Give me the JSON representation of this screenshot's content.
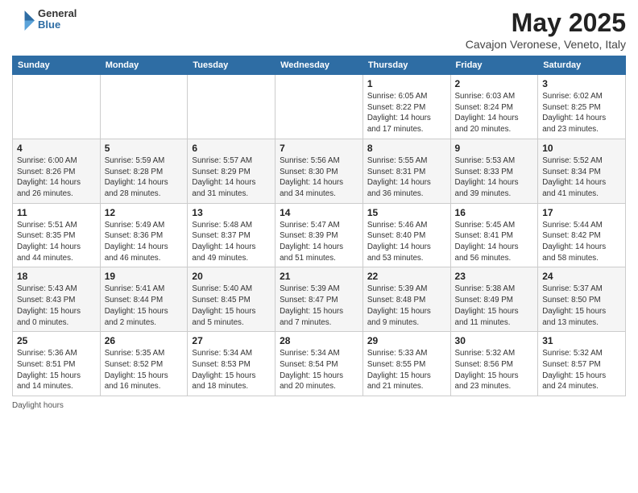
{
  "logo": {
    "general": "General",
    "blue": "Blue"
  },
  "title": {
    "month_year": "May 2025",
    "location": "Cavajon Veronese, Veneto, Italy"
  },
  "days_of_week": [
    "Sunday",
    "Monday",
    "Tuesday",
    "Wednesday",
    "Thursday",
    "Friday",
    "Saturday"
  ],
  "weeks": [
    [
      {
        "day": "",
        "info": ""
      },
      {
        "day": "",
        "info": ""
      },
      {
        "day": "",
        "info": ""
      },
      {
        "day": "",
        "info": ""
      },
      {
        "day": "1",
        "info": "Sunrise: 6:05 AM\nSunset: 8:22 PM\nDaylight: 14 hours\nand 17 minutes."
      },
      {
        "day": "2",
        "info": "Sunrise: 6:03 AM\nSunset: 8:24 PM\nDaylight: 14 hours\nand 20 minutes."
      },
      {
        "day": "3",
        "info": "Sunrise: 6:02 AM\nSunset: 8:25 PM\nDaylight: 14 hours\nand 23 minutes."
      }
    ],
    [
      {
        "day": "4",
        "info": "Sunrise: 6:00 AM\nSunset: 8:26 PM\nDaylight: 14 hours\nand 26 minutes."
      },
      {
        "day": "5",
        "info": "Sunrise: 5:59 AM\nSunset: 8:28 PM\nDaylight: 14 hours\nand 28 minutes."
      },
      {
        "day": "6",
        "info": "Sunrise: 5:57 AM\nSunset: 8:29 PM\nDaylight: 14 hours\nand 31 minutes."
      },
      {
        "day": "7",
        "info": "Sunrise: 5:56 AM\nSunset: 8:30 PM\nDaylight: 14 hours\nand 34 minutes."
      },
      {
        "day": "8",
        "info": "Sunrise: 5:55 AM\nSunset: 8:31 PM\nDaylight: 14 hours\nand 36 minutes."
      },
      {
        "day": "9",
        "info": "Sunrise: 5:53 AM\nSunset: 8:33 PM\nDaylight: 14 hours\nand 39 minutes."
      },
      {
        "day": "10",
        "info": "Sunrise: 5:52 AM\nSunset: 8:34 PM\nDaylight: 14 hours\nand 41 minutes."
      }
    ],
    [
      {
        "day": "11",
        "info": "Sunrise: 5:51 AM\nSunset: 8:35 PM\nDaylight: 14 hours\nand 44 minutes."
      },
      {
        "day": "12",
        "info": "Sunrise: 5:49 AM\nSunset: 8:36 PM\nDaylight: 14 hours\nand 46 minutes."
      },
      {
        "day": "13",
        "info": "Sunrise: 5:48 AM\nSunset: 8:37 PM\nDaylight: 14 hours\nand 49 minutes."
      },
      {
        "day": "14",
        "info": "Sunrise: 5:47 AM\nSunset: 8:39 PM\nDaylight: 14 hours\nand 51 minutes."
      },
      {
        "day": "15",
        "info": "Sunrise: 5:46 AM\nSunset: 8:40 PM\nDaylight: 14 hours\nand 53 minutes."
      },
      {
        "day": "16",
        "info": "Sunrise: 5:45 AM\nSunset: 8:41 PM\nDaylight: 14 hours\nand 56 minutes."
      },
      {
        "day": "17",
        "info": "Sunrise: 5:44 AM\nSunset: 8:42 PM\nDaylight: 14 hours\nand 58 minutes."
      }
    ],
    [
      {
        "day": "18",
        "info": "Sunrise: 5:43 AM\nSunset: 8:43 PM\nDaylight: 15 hours\nand 0 minutes."
      },
      {
        "day": "19",
        "info": "Sunrise: 5:41 AM\nSunset: 8:44 PM\nDaylight: 15 hours\nand 2 minutes."
      },
      {
        "day": "20",
        "info": "Sunrise: 5:40 AM\nSunset: 8:45 PM\nDaylight: 15 hours\nand 5 minutes."
      },
      {
        "day": "21",
        "info": "Sunrise: 5:39 AM\nSunset: 8:47 PM\nDaylight: 15 hours\nand 7 minutes."
      },
      {
        "day": "22",
        "info": "Sunrise: 5:39 AM\nSunset: 8:48 PM\nDaylight: 15 hours\nand 9 minutes."
      },
      {
        "day": "23",
        "info": "Sunrise: 5:38 AM\nSunset: 8:49 PM\nDaylight: 15 hours\nand 11 minutes."
      },
      {
        "day": "24",
        "info": "Sunrise: 5:37 AM\nSunset: 8:50 PM\nDaylight: 15 hours\nand 13 minutes."
      }
    ],
    [
      {
        "day": "25",
        "info": "Sunrise: 5:36 AM\nSunset: 8:51 PM\nDaylight: 15 hours\nand 14 minutes."
      },
      {
        "day": "26",
        "info": "Sunrise: 5:35 AM\nSunset: 8:52 PM\nDaylight: 15 hours\nand 16 minutes."
      },
      {
        "day": "27",
        "info": "Sunrise: 5:34 AM\nSunset: 8:53 PM\nDaylight: 15 hours\nand 18 minutes."
      },
      {
        "day": "28",
        "info": "Sunrise: 5:34 AM\nSunset: 8:54 PM\nDaylight: 15 hours\nand 20 minutes."
      },
      {
        "day": "29",
        "info": "Sunrise: 5:33 AM\nSunset: 8:55 PM\nDaylight: 15 hours\nand 21 minutes."
      },
      {
        "day": "30",
        "info": "Sunrise: 5:32 AM\nSunset: 8:56 PM\nDaylight: 15 hours\nand 23 minutes."
      },
      {
        "day": "31",
        "info": "Sunrise: 5:32 AM\nSunset: 8:57 PM\nDaylight: 15 hours\nand 24 minutes."
      }
    ]
  ],
  "footer": {
    "daylight_label": "Daylight hours"
  }
}
